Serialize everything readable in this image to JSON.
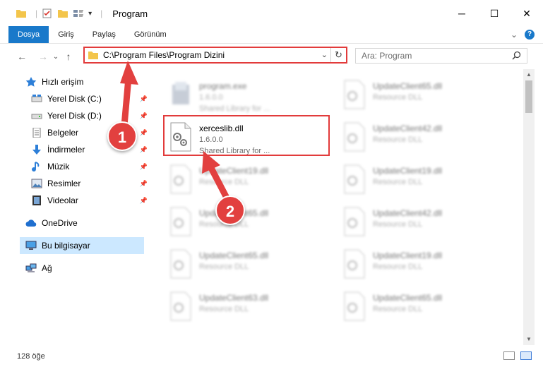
{
  "window": {
    "title": "Program",
    "minimize": "─",
    "maximize": "☐",
    "close": "✕"
  },
  "ribbon": {
    "tabs": [
      "Dosya",
      "Giriş",
      "Paylaş",
      "Görünüm"
    ],
    "expand": "⌄",
    "help": "?"
  },
  "nav": {
    "back": "←",
    "forward": "→",
    "recent": "⌄",
    "up": "↑",
    "address": "C:\\Program Files\\Program Dizini",
    "address_dropdown": "⌄",
    "refresh": "↻",
    "search_placeholder": "Ara: Program"
  },
  "sidebar": {
    "items": [
      {
        "label": "Hızlı erişim",
        "icon": "star-icon",
        "pinned": false
      },
      {
        "label": "Yerel Disk (C:)",
        "icon": "drive-icon",
        "pinned": true
      },
      {
        "label": "Yerel Disk (D:)",
        "icon": "drive-icon",
        "pinned": true
      },
      {
        "label": "Belgeler",
        "icon": "documents-icon",
        "pinned": true
      },
      {
        "label": "İndirmeler",
        "icon": "download-icon",
        "pinned": true
      },
      {
        "label": "Müzik",
        "icon": "music-icon",
        "pinned": true
      },
      {
        "label": "Resimler",
        "icon": "pictures-icon",
        "pinned": true
      },
      {
        "label": "Videolar",
        "icon": "videos-icon",
        "pinned": true
      },
      {
        "label": "OneDrive",
        "icon": "cloud-icon",
        "pinned": false
      },
      {
        "label": "Bu bilgisayar",
        "icon": "computer-icon",
        "pinned": false
      },
      {
        "label": "Ağ",
        "icon": "network-icon",
        "pinned": false
      }
    ],
    "pin_glyph": "📌"
  },
  "files": [
    {
      "name": "program.exe",
      "version": "1.6.0.0",
      "type": "Shared Library for ..."
    },
    {
      "name": "UpdateClient65.dll",
      "version": "",
      "type": "Resource DLL"
    },
    {
      "name": "xerceslib.dll",
      "version": "1.6.0.0",
      "type": "Shared Library for ..."
    },
    {
      "name": "UpdateClient42.dll",
      "version": "",
      "type": "Resource DLL"
    },
    {
      "name": "UpdateClient19.dll",
      "version": "",
      "type": "Resource DLL"
    },
    {
      "name": "UpdateClient19.dll",
      "version": "",
      "type": "Resource DLL"
    },
    {
      "name": "UpdateClient65.dll",
      "version": "",
      "type": "Resource DLL"
    },
    {
      "name": "UpdateClient42.dll",
      "version": "",
      "type": "Resource DLL"
    },
    {
      "name": "UpdateClient65.dll",
      "version": "",
      "type": "Resource DLL"
    },
    {
      "name": "UpdateClient19.dll",
      "version": "",
      "type": "Resource DLL"
    },
    {
      "name": "UpdateClient63.dll",
      "version": "",
      "type": "Resource DLL"
    },
    {
      "name": "UpdateClient65.dll",
      "version": "",
      "type": "Resource DLL"
    }
  ],
  "annotations": {
    "step1": "1",
    "step2": "2"
  },
  "status": {
    "item_count": "128 öğe"
  },
  "colors": {
    "accent": "#1979ca",
    "highlight": "#e23b3b",
    "selection": "#cce8ff"
  }
}
